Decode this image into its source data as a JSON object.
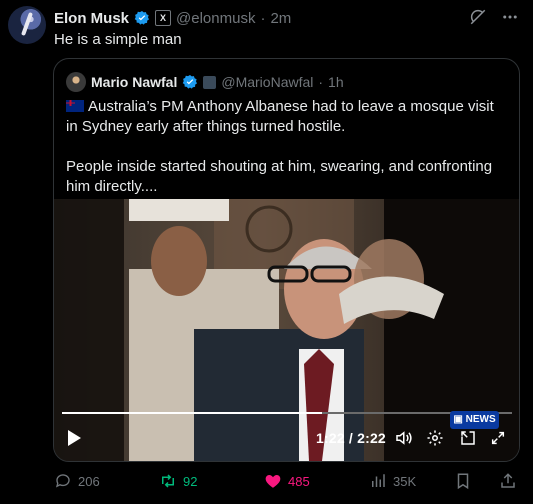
{
  "tweet": {
    "author_name": "Elon Musk",
    "author_handle": "@elonmusk",
    "separator": "·",
    "time": "2m",
    "text": "He is a simple man"
  },
  "quote": {
    "author_name": "Mario Nawfal",
    "author_handle": "@MarioNawfal",
    "separator": "·",
    "time": "1h",
    "text_line1": "Australia’s PM Anthony Albanese had to leave a mosque visit in Sydney early after things turned hostile.",
    "text_line2": "People inside started shouting at him, swearing, and confronting him directly....",
    "video": {
      "time_display": "1:22 / 2:22",
      "progress": 0.577,
      "watermark": "NEWS"
    }
  },
  "actions": {
    "replies": "206",
    "reposts": "92",
    "likes": "485",
    "views": "35K"
  },
  "colors": {
    "verified": "#1d9bf0",
    "repost": "#00ba7c",
    "like": "#f91880",
    "muted": "#71767b"
  }
}
